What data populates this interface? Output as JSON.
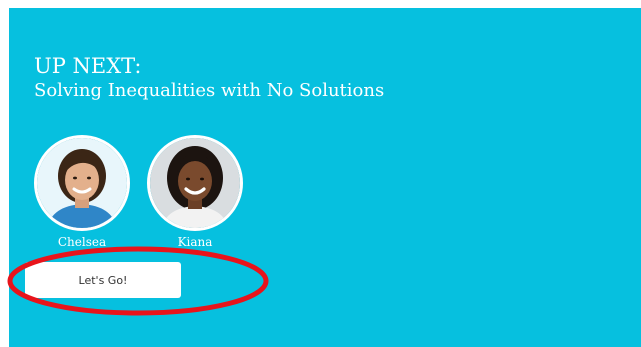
{
  "up_next": {
    "heading": "UP NEXT:",
    "lesson_title": "Solving Inequalities with No Solutions"
  },
  "tutors": [
    {
      "name": "Chelsea",
      "avatar_icon": "tutor-photo-chelsea"
    },
    {
      "name": "Kiana",
      "avatar_icon": "tutor-photo-kiana"
    }
  ],
  "cta": {
    "label": "Let's Go!"
  },
  "colors": {
    "background": "#06c0df",
    "button": "#ffffff",
    "annotation_ring": "#e8141b"
  }
}
